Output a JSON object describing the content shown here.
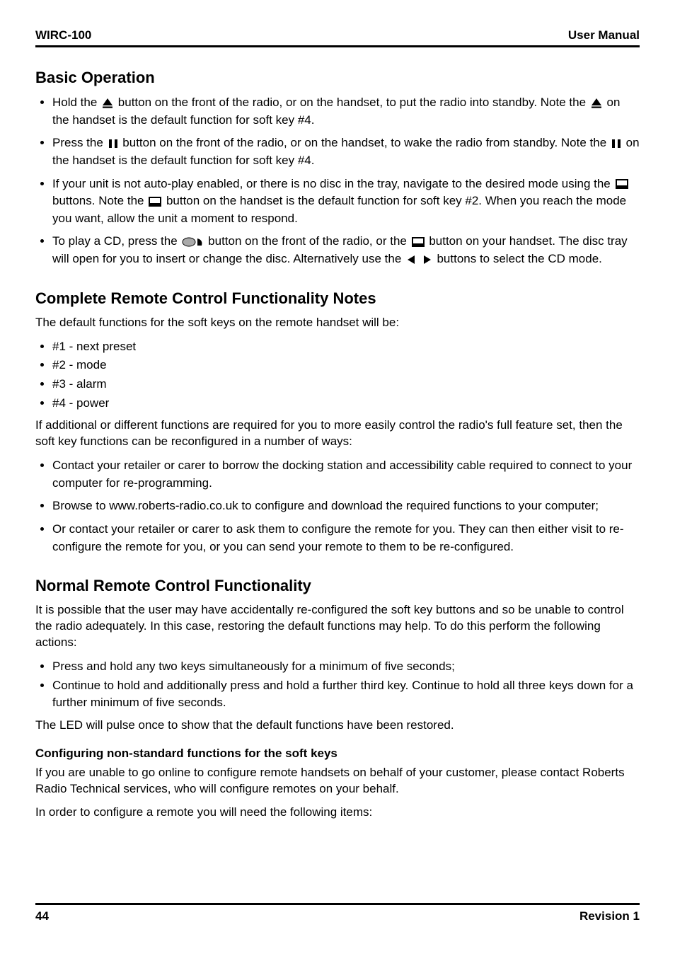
{
  "header": {
    "left": "WIRC-100",
    "right": "User Manual"
  },
  "section_basic": {
    "title": "Basic Operation",
    "bullets": [
      {
        "pre": "Hold the ",
        "icon": "eject1",
        "mid": " button on the front of the radio, or on the handset, to put the radio into standby. Note the ",
        "icon2": "eject2",
        "post": " on the handset is the default function for soft key #4."
      },
      {
        "pre": "Press the ",
        "icon": "pause1",
        "mid": " button on the front of the radio, or on the handset, to wake the radio from standby. Note the ",
        "icon2": "pause2",
        "post": " on the handset is the default function for soft key #4."
      },
      {
        "pre": "If your unit is not auto-play enabled, or there is no disc in the tray, navigate to the desired mode using the ",
        "icon": "mode-icon",
        "mid": " buttons. Note the ",
        "icon2": "mode-icon",
        "post": " button on the handset is the default function for soft key #2. When you reach the mode you want, allow the unit a moment to respond."
      },
      {
        "pre": "To play a CD, press the ",
        "icon": "eject-cd",
        "mid": " button on the front of the radio, or the ",
        "icon2": "mode-icon",
        "e1post": " button on your handset. The disc tray will open for you to insert or change the disc. Alternatively use the ",
        "skip_icons": "skip",
        "post": " buttons to select the CD mode."
      }
    ]
  },
  "section_remote_notes": {
    "title": "Complete Remote Control Functionality Notes",
    "p1": "The default functions for the soft keys on the remote handset will be:",
    "list1": [
      "#1 - next preset",
      "#2 - mode",
      "#3 - alarm",
      "#4 - power"
    ],
    "p2": "If additional or different functions are required for you to more easily control the radio's full feature set, then the soft key functions can be reconfigured in a number of ways:",
    "list2": [
      "Contact your retailer or carer to borrow the docking station and accessibility cable required to connect to your computer for re-programming.",
      "Browse to www.roberts-radio.co.uk to configure and download the required functions to your computer;",
      "Or contact your retailer or carer to ask them to configure the remote for you. They can then either visit to re-configure the remote for you, or you can send your remote to them to be re-configured."
    ]
  },
  "section_normal": {
    "title": "Normal Remote Control Functionality",
    "p1": "It is possible that the user may have accidentally re-configured the soft key buttons and so be unable to control the radio adequately. In this case, restoring the default functions may help. To do this perform the following actions:",
    "list": [
      "Press and hold any two keys simultaneously for a minimum of five seconds;",
      "Continue to hold and additionally press and hold a further third key. Continue to hold all three keys down for a further minimum of five seconds."
    ],
    "p2": "The LED will pulse once to show that the default functions have been restored.",
    "subheading": "Configuring non-standard functions for the soft keys",
    "p3": "If you are unable to go online to configure remote handsets on behalf of your customer, please contact Roberts Radio Technical services, who will configure remotes on your behalf.",
    "p4": "In order to configure a remote you will need the following items:"
  },
  "footer": {
    "left": "44",
    "right": "Revision 1"
  }
}
